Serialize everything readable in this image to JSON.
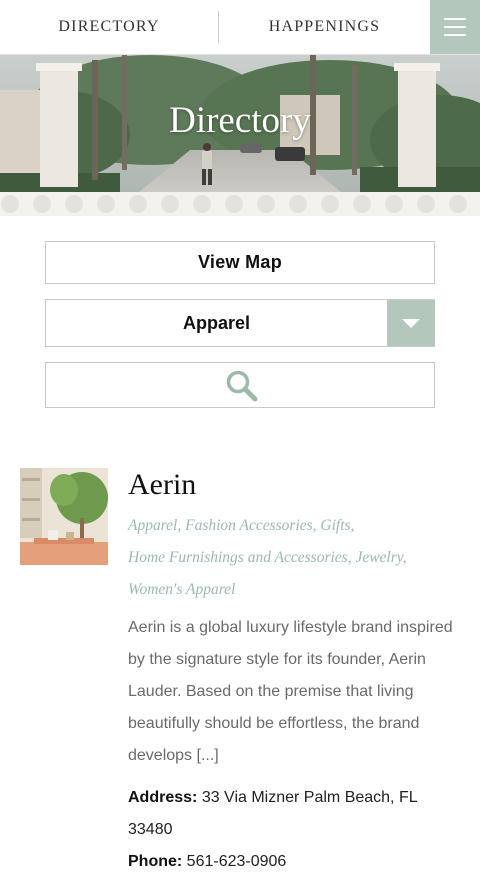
{
  "nav": {
    "directory_label": "DIRECTORY",
    "happenings_label": "HAPPENINGS",
    "menu_icon": "hamburger-menu-icon"
  },
  "hero": {
    "title": "Directory"
  },
  "controls": {
    "view_map_label": "View Map",
    "category_selected": "Apparel",
    "search_icon": "magnifier-icon"
  },
  "listing": {
    "name": "Aerin",
    "categories_line1": "Apparel, Fashion Accessories, Gifts,",
    "categories_line2": "Home Furnishings and Accessories, Jewelry,",
    "categories_line3": "Women's Apparel",
    "description": "Aerin is a global luxury lifestyle brand inspired by the signature style for its founder, Aerin Lauder. Based on the premise that living beautifully should be effortless, the brand develops [...]",
    "address_label": "Address:",
    "address_value": "33 Via Mizner Palm Beach, FL 33480",
    "phone_label": "Phone:",
    "phone_value": "561-623-0906"
  },
  "colors": {
    "accent_sage": "#b4c7bd",
    "category_text": "#9bbaa9"
  }
}
